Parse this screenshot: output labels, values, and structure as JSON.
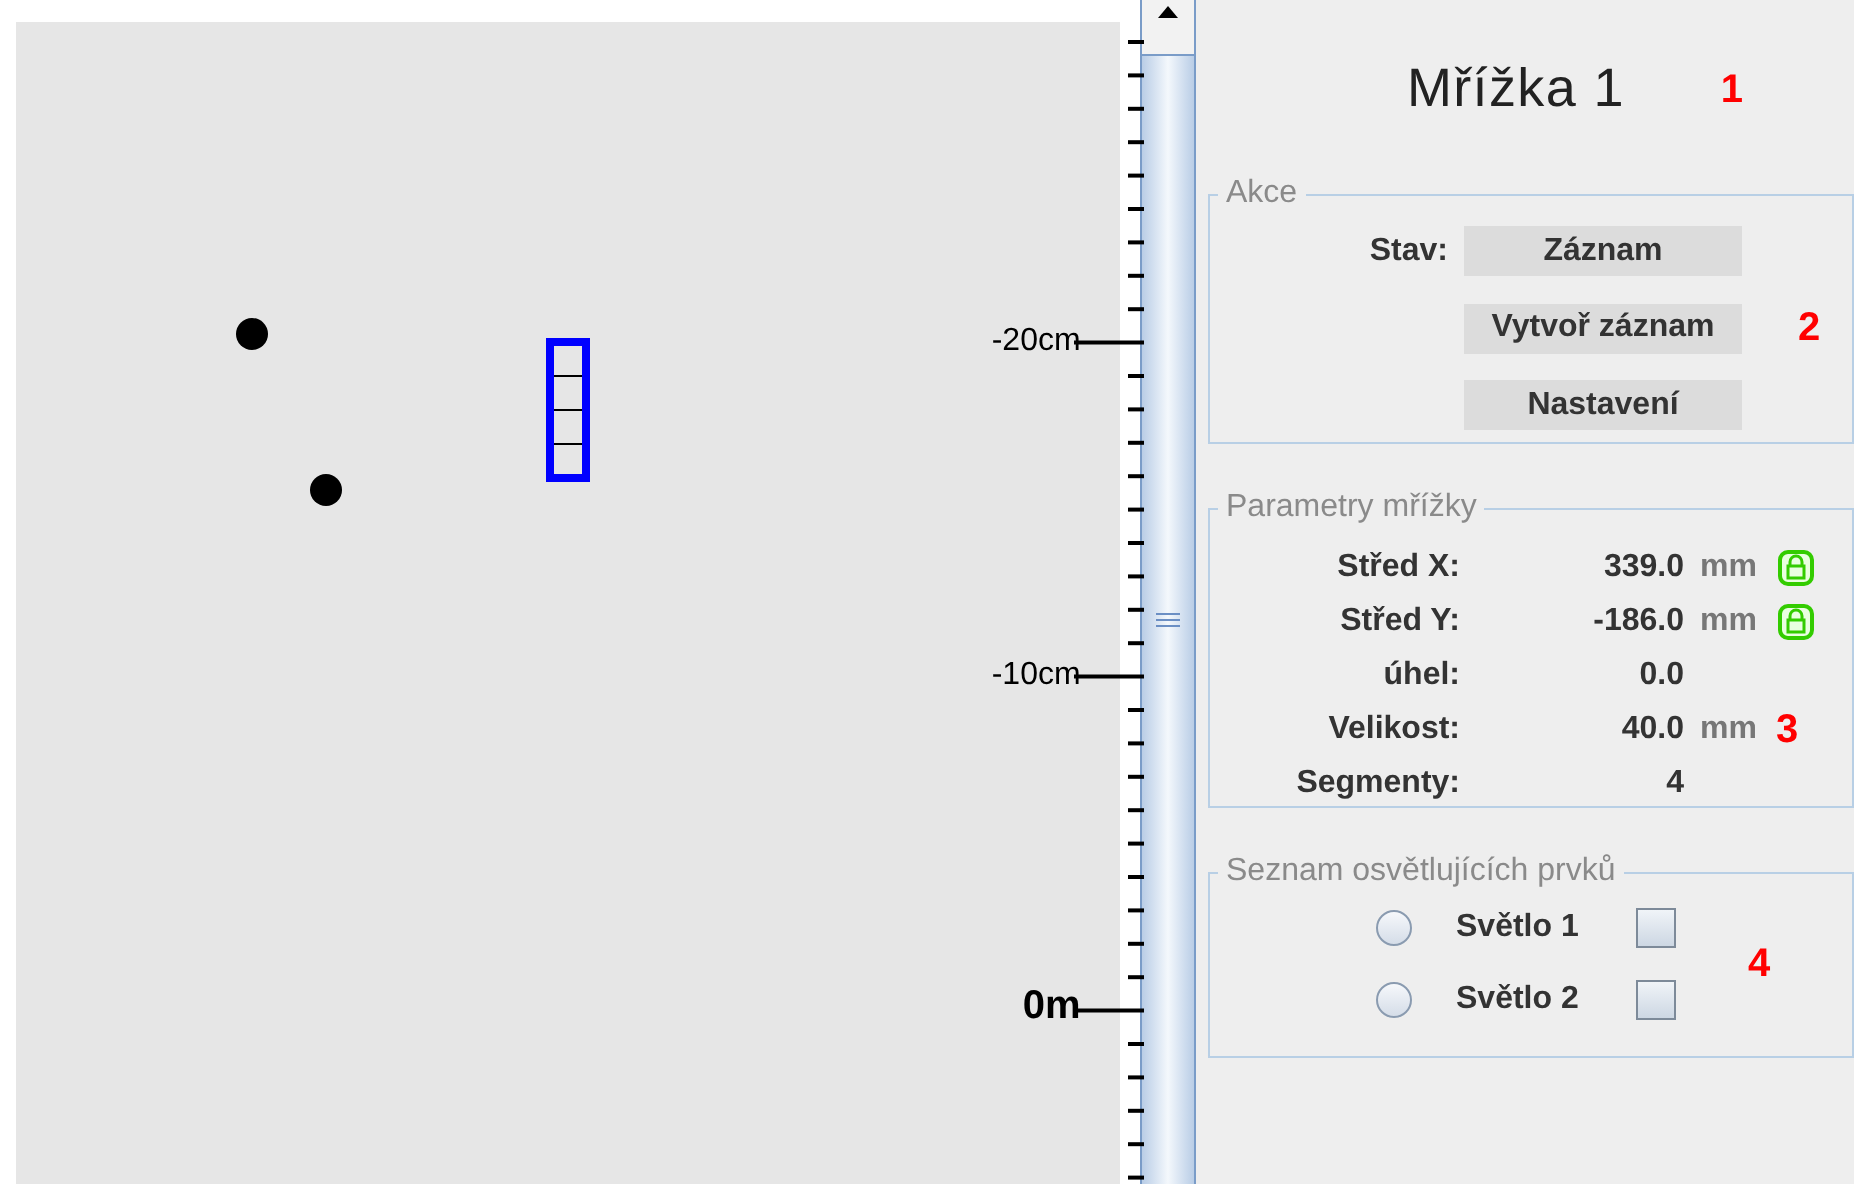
{
  "ruler": {
    "labels": [
      {
        "text": "-20cm",
        "major": false
      },
      {
        "text": "-10cm",
        "major": false
      },
      {
        "text": "0m",
        "major": true
      }
    ]
  },
  "panel": {
    "title": "Mřížka 1",
    "title_marker": "1",
    "actions": {
      "legend": "Akce",
      "status_label": "Stav:",
      "status_button": "Záznam",
      "buttons": [
        "Vytvoř záznam",
        "Nastavení"
      ],
      "marker": "2"
    },
    "parameters": {
      "legend": "Parametry mřížky",
      "marker": "3",
      "rows": [
        {
          "label": "Střed X:",
          "value": "339.0",
          "unit": "mm",
          "lock": true
        },
        {
          "label": "Střed Y:",
          "value": "-186.0",
          "unit": "mm",
          "lock": true
        },
        {
          "label": "úhel:",
          "value": "0.0",
          "lock": false
        },
        {
          "label": "Velikost:",
          "value": "40.0",
          "unit": "mm",
          "lock": false
        },
        {
          "label": "Segmenty:",
          "value": "4",
          "lock": false
        }
      ]
    },
    "lights": {
      "legend": "Seznam osvětlujících prvků",
      "marker": "4",
      "items": [
        {
          "label": "Světlo 1",
          "selected": false,
          "checked": false
        },
        {
          "label": "Světlo 2",
          "selected": false,
          "checked": false
        }
      ]
    }
  }
}
